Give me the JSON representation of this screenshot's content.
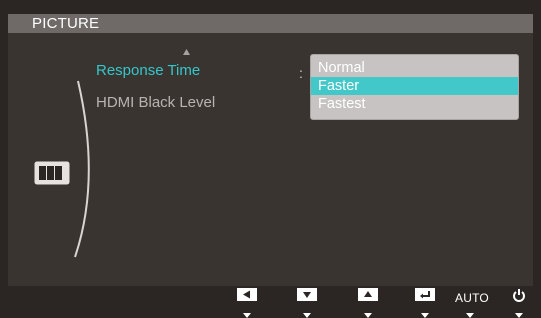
{
  "osd": {
    "title": "PICTURE"
  },
  "menu": {
    "items": [
      {
        "label": "Response Time",
        "state": "active"
      },
      {
        "label": "HDMI Black Level",
        "state": "inactive"
      }
    ],
    "colon": ":"
  },
  "dropdown": {
    "options": [
      {
        "label": "Normal",
        "selected": false
      },
      {
        "label": "Faster",
        "selected": true
      },
      {
        "label": "Fastest",
        "selected": false
      }
    ]
  },
  "bottom_bar": {
    "buttons": [
      {
        "icon": "left-arrow-icon"
      },
      {
        "icon": "down-arrow-icon"
      },
      {
        "icon": "up-arrow-icon"
      },
      {
        "icon": "enter-icon"
      },
      {
        "label": "AUTO"
      },
      {
        "icon": "power-icon"
      }
    ]
  },
  "colors": {
    "accent": "#33c7ca",
    "background": "#2b2623",
    "panel": "#3a3431",
    "titlebar": "#6f6a68",
    "dropdown": "#c6c3c2"
  }
}
